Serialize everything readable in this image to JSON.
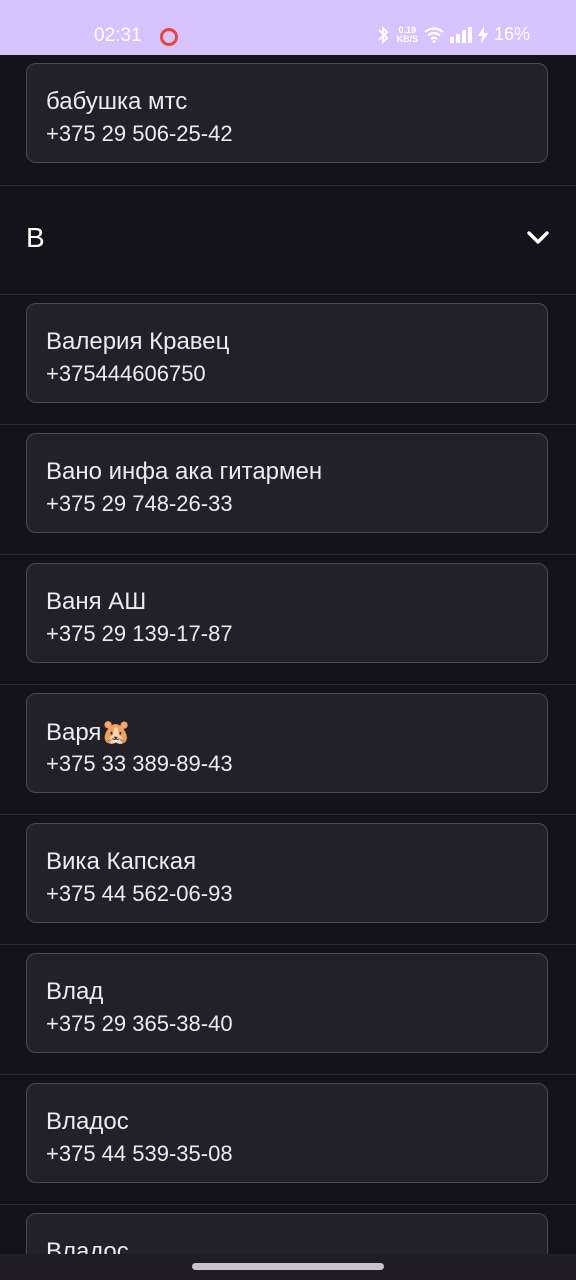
{
  "status_bar": {
    "time": "02:31",
    "net_speed_value": "0.19",
    "net_speed_unit": "KB/S",
    "battery": "16%",
    "icons": [
      "record-icon",
      "bluetooth-icon",
      "wifi-icon",
      "signal-icon",
      "charging-icon"
    ]
  },
  "contacts_top": [
    {
      "name": "бабушка мтс",
      "phone": "+375 29 506-25-42"
    }
  ],
  "section": {
    "letter": "В",
    "icon": "chevron-down-icon"
  },
  "contacts": [
    {
      "name": "Валерия Кравец",
      "phone": "+375444606750"
    },
    {
      "name": "Вано инфа ака гитармен",
      "phone": "+375 29 748-26-33"
    },
    {
      "name": "Ваня АШ",
      "phone": "+375 29 139-17-87"
    },
    {
      "name": "Варя🐹",
      "phone": "+375 33 389-89-43"
    },
    {
      "name": "Вика Капская",
      "phone": "+375 44 562-06-93"
    },
    {
      "name": "Влад",
      "phone": "+375 29 365-38-40"
    },
    {
      "name": "Владос",
      "phone": "+375 44 539-35-08"
    },
    {
      "name": "Владос",
      "phone": ""
    }
  ],
  "colors": {
    "status_bar_bg": "#d8c2ff",
    "background": "#15131a",
    "card_bg": "#222028",
    "card_border": "#4a4850",
    "text": "#ecebef"
  }
}
